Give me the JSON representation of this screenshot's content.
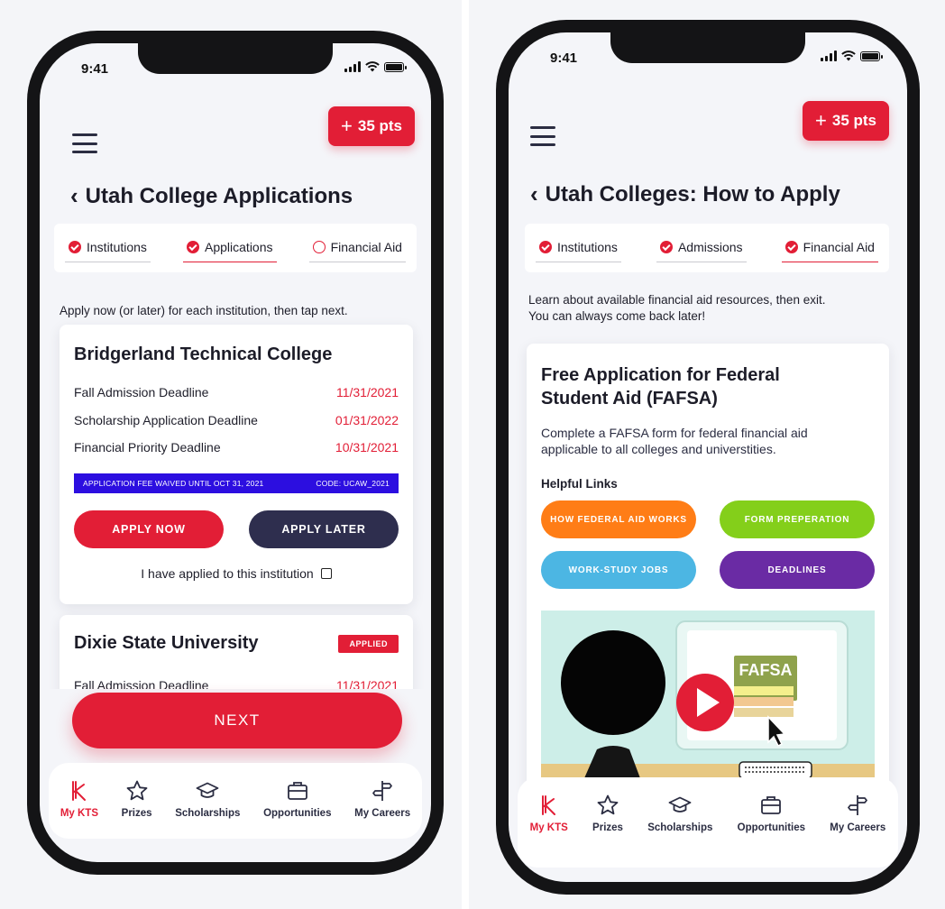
{
  "status_time": "9:41",
  "colors": {
    "primary_red": "#e21e36",
    "navy": "#2e2e4e",
    "fee_banner": "#2c0ee0",
    "orange": "#ff7d16",
    "lime": "#84cf1a",
    "sky": "#4cb6e3",
    "purple": "#6a2ba4"
  },
  "points_label": "35 pts",
  "left": {
    "title": "Utah College Applications",
    "tabs": [
      {
        "label": "Institutions",
        "state": "done"
      },
      {
        "label": "Applications",
        "state": "done"
      },
      {
        "label": "Financial Aid",
        "state": "todo"
      }
    ],
    "instruction": "Apply now (or later) for each institution, then tap next.",
    "card1": {
      "name": "Bridgerland Technical College",
      "deadlines": [
        {
          "label": "Fall Admission Deadline",
          "date": "11/31/2021"
        },
        {
          "label": "Scholarship Application Deadline",
          "date": "01/31/2022"
        },
        {
          "label": "Financial Priority Deadline",
          "date": "10/31/2021"
        }
      ],
      "fee_note": "APPLICATION FEE WAIVED UNTIL OCT 31, 2021",
      "fee_code": "CODE: UCAW_2021",
      "apply_now": "APPLY NOW",
      "apply_later": "APPLY LATER",
      "applied_checkbox": "I have applied to this institution"
    },
    "card2": {
      "name": "Dixie State University",
      "badge": "APPLIED",
      "deadline_label": "Fall Admission Deadline",
      "deadline_date": "11/31/2021"
    },
    "next_label": "NEXT"
  },
  "right": {
    "title": "Utah Colleges: How to Apply",
    "tabs": [
      {
        "label": "Institutions",
        "state": "done"
      },
      {
        "label": "Admissions",
        "state": "done"
      },
      {
        "label": "Financial Aid",
        "state": "done"
      }
    ],
    "instruction_line1": "Learn about available financial aid resources, then exit.",
    "instruction_line2": "You can always come back later!",
    "card": {
      "title_line1": "Free Application for Federal",
      "title_line2": "Student Aid (FAFSA)",
      "desc_line1": "Complete a FAFSA form for federal financial aid",
      "desc_line2": "applicable to all colleges and universtities.",
      "links_label": "Helpful Links",
      "links": [
        "HOW FEDERAL AID WORKS",
        "FORM PREPERATION",
        "WORK-STUDY JOBS",
        "DEADLINES"
      ],
      "video_sign": "FAFSA"
    }
  },
  "nav": [
    {
      "label": "My KTS",
      "icon": "kts-logo-icon"
    },
    {
      "label": "Prizes",
      "icon": "star-icon"
    },
    {
      "label": "Scholarships",
      "icon": "graduation-cap-icon"
    },
    {
      "label": "Opportunities",
      "icon": "briefcase-icon"
    },
    {
      "label": "My Careers",
      "icon": "signpost-icon"
    }
  ]
}
